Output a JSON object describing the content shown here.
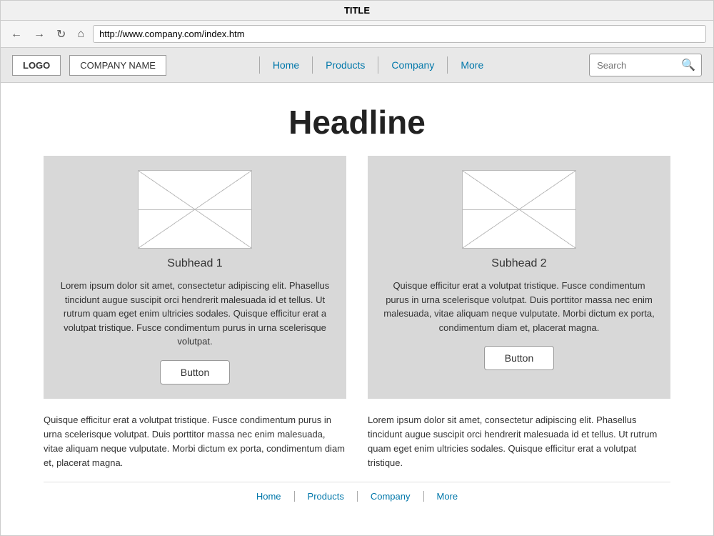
{
  "browser": {
    "title": "TITLE",
    "url": "http://www.company.com/index.htm",
    "back_label": "←",
    "forward_label": "→",
    "refresh_label": "↻",
    "home_label": "⌂"
  },
  "header": {
    "logo": "LOGO",
    "company_name": "COMPANY NAME",
    "nav": {
      "items": [
        {
          "label": "Home",
          "href": "#"
        },
        {
          "label": "Products",
          "href": "#"
        },
        {
          "label": "Company",
          "href": "#"
        },
        {
          "label": "More",
          "href": "#"
        }
      ]
    },
    "search_placeholder": "Search",
    "search_icon": "🔍"
  },
  "main": {
    "headline": "Headline",
    "cards": [
      {
        "subhead": "Subhead 1",
        "body": "Lorem ipsum dolor sit amet, consectetur adipiscing elit. Phasellus tincidunt augue suscipit orci hendrerit malesuada id et tellus. Ut rutrum quam eget enim ultricies sodales. Quisque efficitur erat a volutpat tristique. Fusce condimentum purus in urna scelerisque volutpat.",
        "button": "Button"
      },
      {
        "subhead": "Subhead 2",
        "body": "Quisque efficitur erat a volutpat tristique. Fusce condimentum purus in urna scelerisque volutpat. Duis porttitor massa nec enim malesuada, vitae aliquam neque vulputate. Morbi dictum ex porta, condimentum diam et, placerat magna.",
        "button": "Button"
      }
    ],
    "text_columns": [
      "Quisque efficitur erat a volutpat tristique. Fusce condimentum purus in urna scelerisque volutpat. Duis porttitor massa nec enim malesuada, vitae aliquam neque vulputate. Morbi dictum ex porta, condimentum diam et, placerat magna.",
      "Lorem ipsum dolor sit amet, consectetur adipiscing elit. Phasellus tincidunt augue suscipit orci hendrerit malesuada id et tellus. Ut rutrum quam eget enim ultricies sodales. Quisque efficitur erat a volutpat tristique."
    ]
  },
  "footer": {
    "nav": {
      "items": [
        {
          "label": "Home",
          "href": "#"
        },
        {
          "label": "Products",
          "href": "#"
        },
        {
          "label": "Company",
          "href": "#"
        },
        {
          "label": "More",
          "href": "#"
        }
      ]
    }
  }
}
